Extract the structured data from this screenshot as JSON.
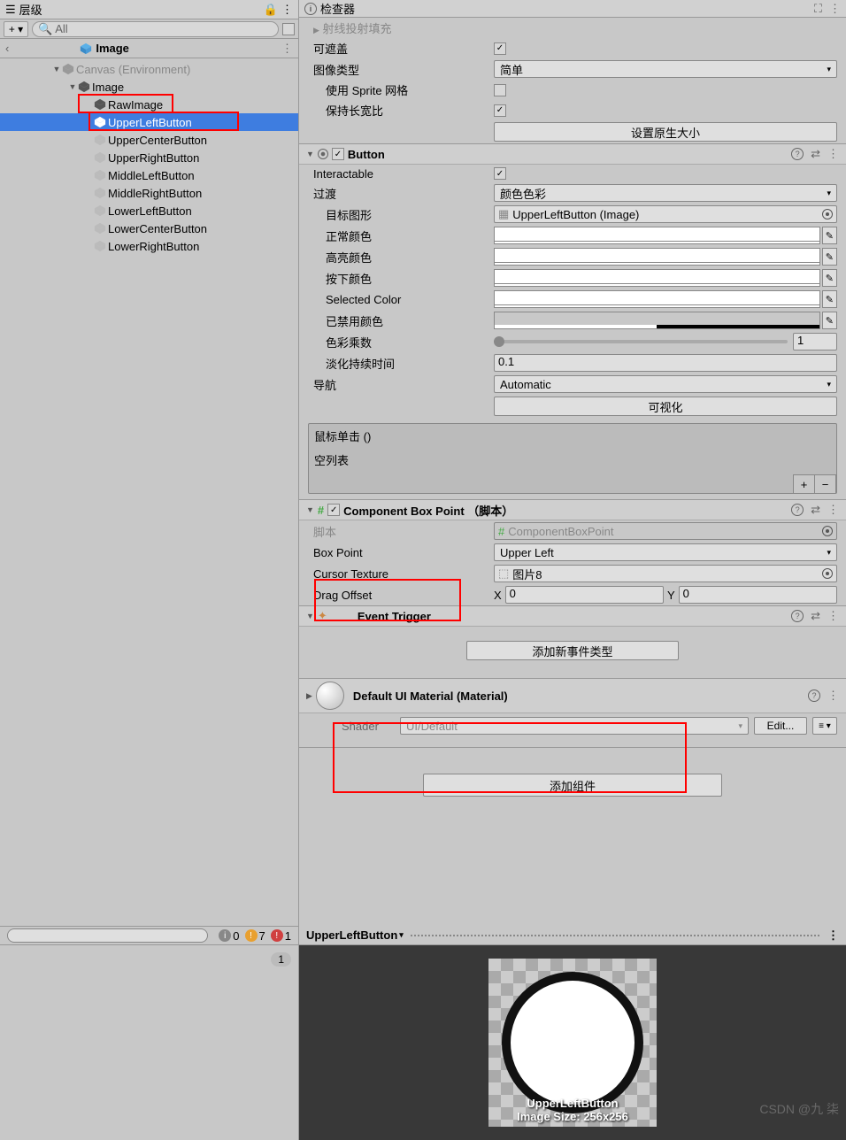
{
  "hierarchy": {
    "title": "层级",
    "searchPrefix": "All",
    "breadcrumb": "Image",
    "items": [
      {
        "label": "Canvas  (Environment)",
        "indent": 0,
        "arrow": "▼",
        "color": "#999"
      },
      {
        "label": "Image",
        "indent": 1,
        "arrow": "▼",
        "color": "#555"
      },
      {
        "label": "RawImage",
        "indent": 2,
        "arrow": "",
        "color": "#555"
      },
      {
        "label": "UpperLeftButton",
        "indent": 2,
        "arrow": "",
        "selected": true
      },
      {
        "label": "UpperCenterButton",
        "indent": 2,
        "arrow": ""
      },
      {
        "label": "UpperRightButton",
        "indent": 2,
        "arrow": ""
      },
      {
        "label": "MiddleLeftButton",
        "indent": 2,
        "arrow": ""
      },
      {
        "label": "MiddleRightButton",
        "indent": 2,
        "arrow": ""
      },
      {
        "label": "LowerLeftButton",
        "indent": 2,
        "arrow": ""
      },
      {
        "label": "LowerCenterButton",
        "indent": 2,
        "arrow": ""
      },
      {
        "label": "LowerRightButton",
        "indent": 2,
        "arrow": ""
      }
    ]
  },
  "inspector": {
    "title": "检查器",
    "raycastFill": "射线投射填充",
    "maskable": "可遮盖",
    "imageType": "图像类型",
    "imageTypeValue": "简单",
    "useSpriteMesh": "使用 Sprite 网格",
    "preserveAspect": "保持长宽比",
    "setNativeSize": "设置原生大小"
  },
  "button": {
    "title": "Button",
    "interactable": "Interactable",
    "transition": "过渡",
    "transitionValue": "颜色色彩",
    "targetGraphic": "目标图形",
    "targetValue": "UpperLeftButton (Image)",
    "normalColor": "正常颜色",
    "highlightColor": "高亮颜色",
    "pressedColor": "按下颜色",
    "selectedColor": "Selected Color",
    "disabledColor": "已禁用颜色",
    "colorMultiplier": "色彩乘数",
    "colorMultValue": "1",
    "fadeDuration": "淡化持续时间",
    "fadeDurationValue": "0.1",
    "navigation": "导航",
    "navigationValue": "Automatic",
    "visualize": "可视化",
    "onClick": "鼠标单击 ()",
    "emptyList": "空列表"
  },
  "script": {
    "title": "Component Box Point （脚本）",
    "scriptLabel": "脚本",
    "scriptValue": "ComponentBoxPoint",
    "boxPoint": "Box Point",
    "boxPointValue": "Upper Left",
    "cursorTexture": "Cursor Texture",
    "cursorValue": "图片8",
    "dragOffset": "Drag Offset",
    "dragX": "X",
    "dragXVal": "0",
    "dragY": "Y",
    "dragYVal": "0"
  },
  "eventTrigger": {
    "title": "Event Trigger",
    "addButton": "添加新事件类型"
  },
  "material": {
    "title": "Default UI Material (Material)",
    "shaderLabel": "Shader",
    "shaderValue": "UI/Default",
    "edit": "Edit..."
  },
  "addComponent": "添加组件",
  "status": {
    "info": "0",
    "warn": "7",
    "error": "1",
    "itemCount": "1"
  },
  "preview": {
    "name": "UpperLeftButton",
    "caption": "UpperLeftButton",
    "size": "Image Size: 256x256"
  },
  "watermark": "CSDN @九 柒"
}
